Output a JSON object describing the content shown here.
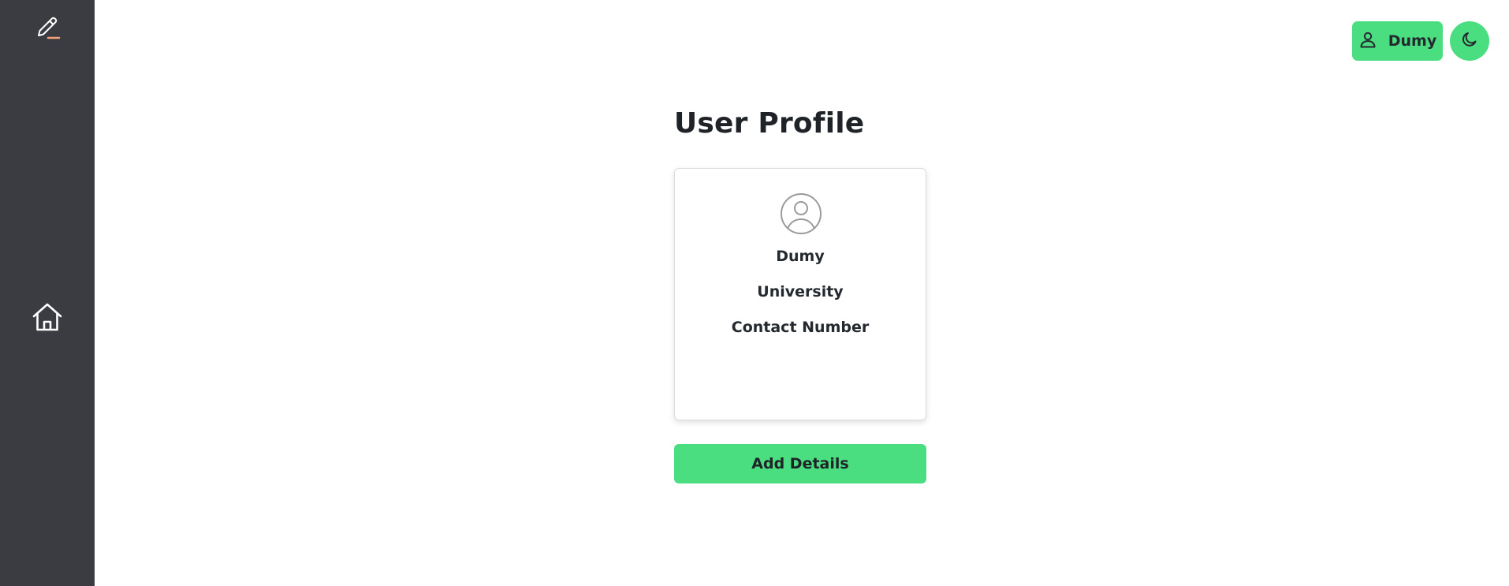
{
  "colors": {
    "sidebar_bg": "#3a3c42",
    "accent_green": "#4ade80",
    "logo_underline": "#f4a07a"
  },
  "sidebar": {
    "logo_icon": "pen-icon",
    "items": [
      {
        "icon": "home-icon"
      }
    ]
  },
  "header": {
    "user_button": {
      "icon": "user-icon",
      "label": "Dumy"
    },
    "theme_toggle": {
      "icon": "moon-icon"
    }
  },
  "main": {
    "title": "User Profile",
    "card": {
      "avatar_icon": "user-circle-icon",
      "name": "Dumy",
      "university": "University",
      "contact": "Contact Number"
    },
    "add_details_label": "Add Details"
  }
}
